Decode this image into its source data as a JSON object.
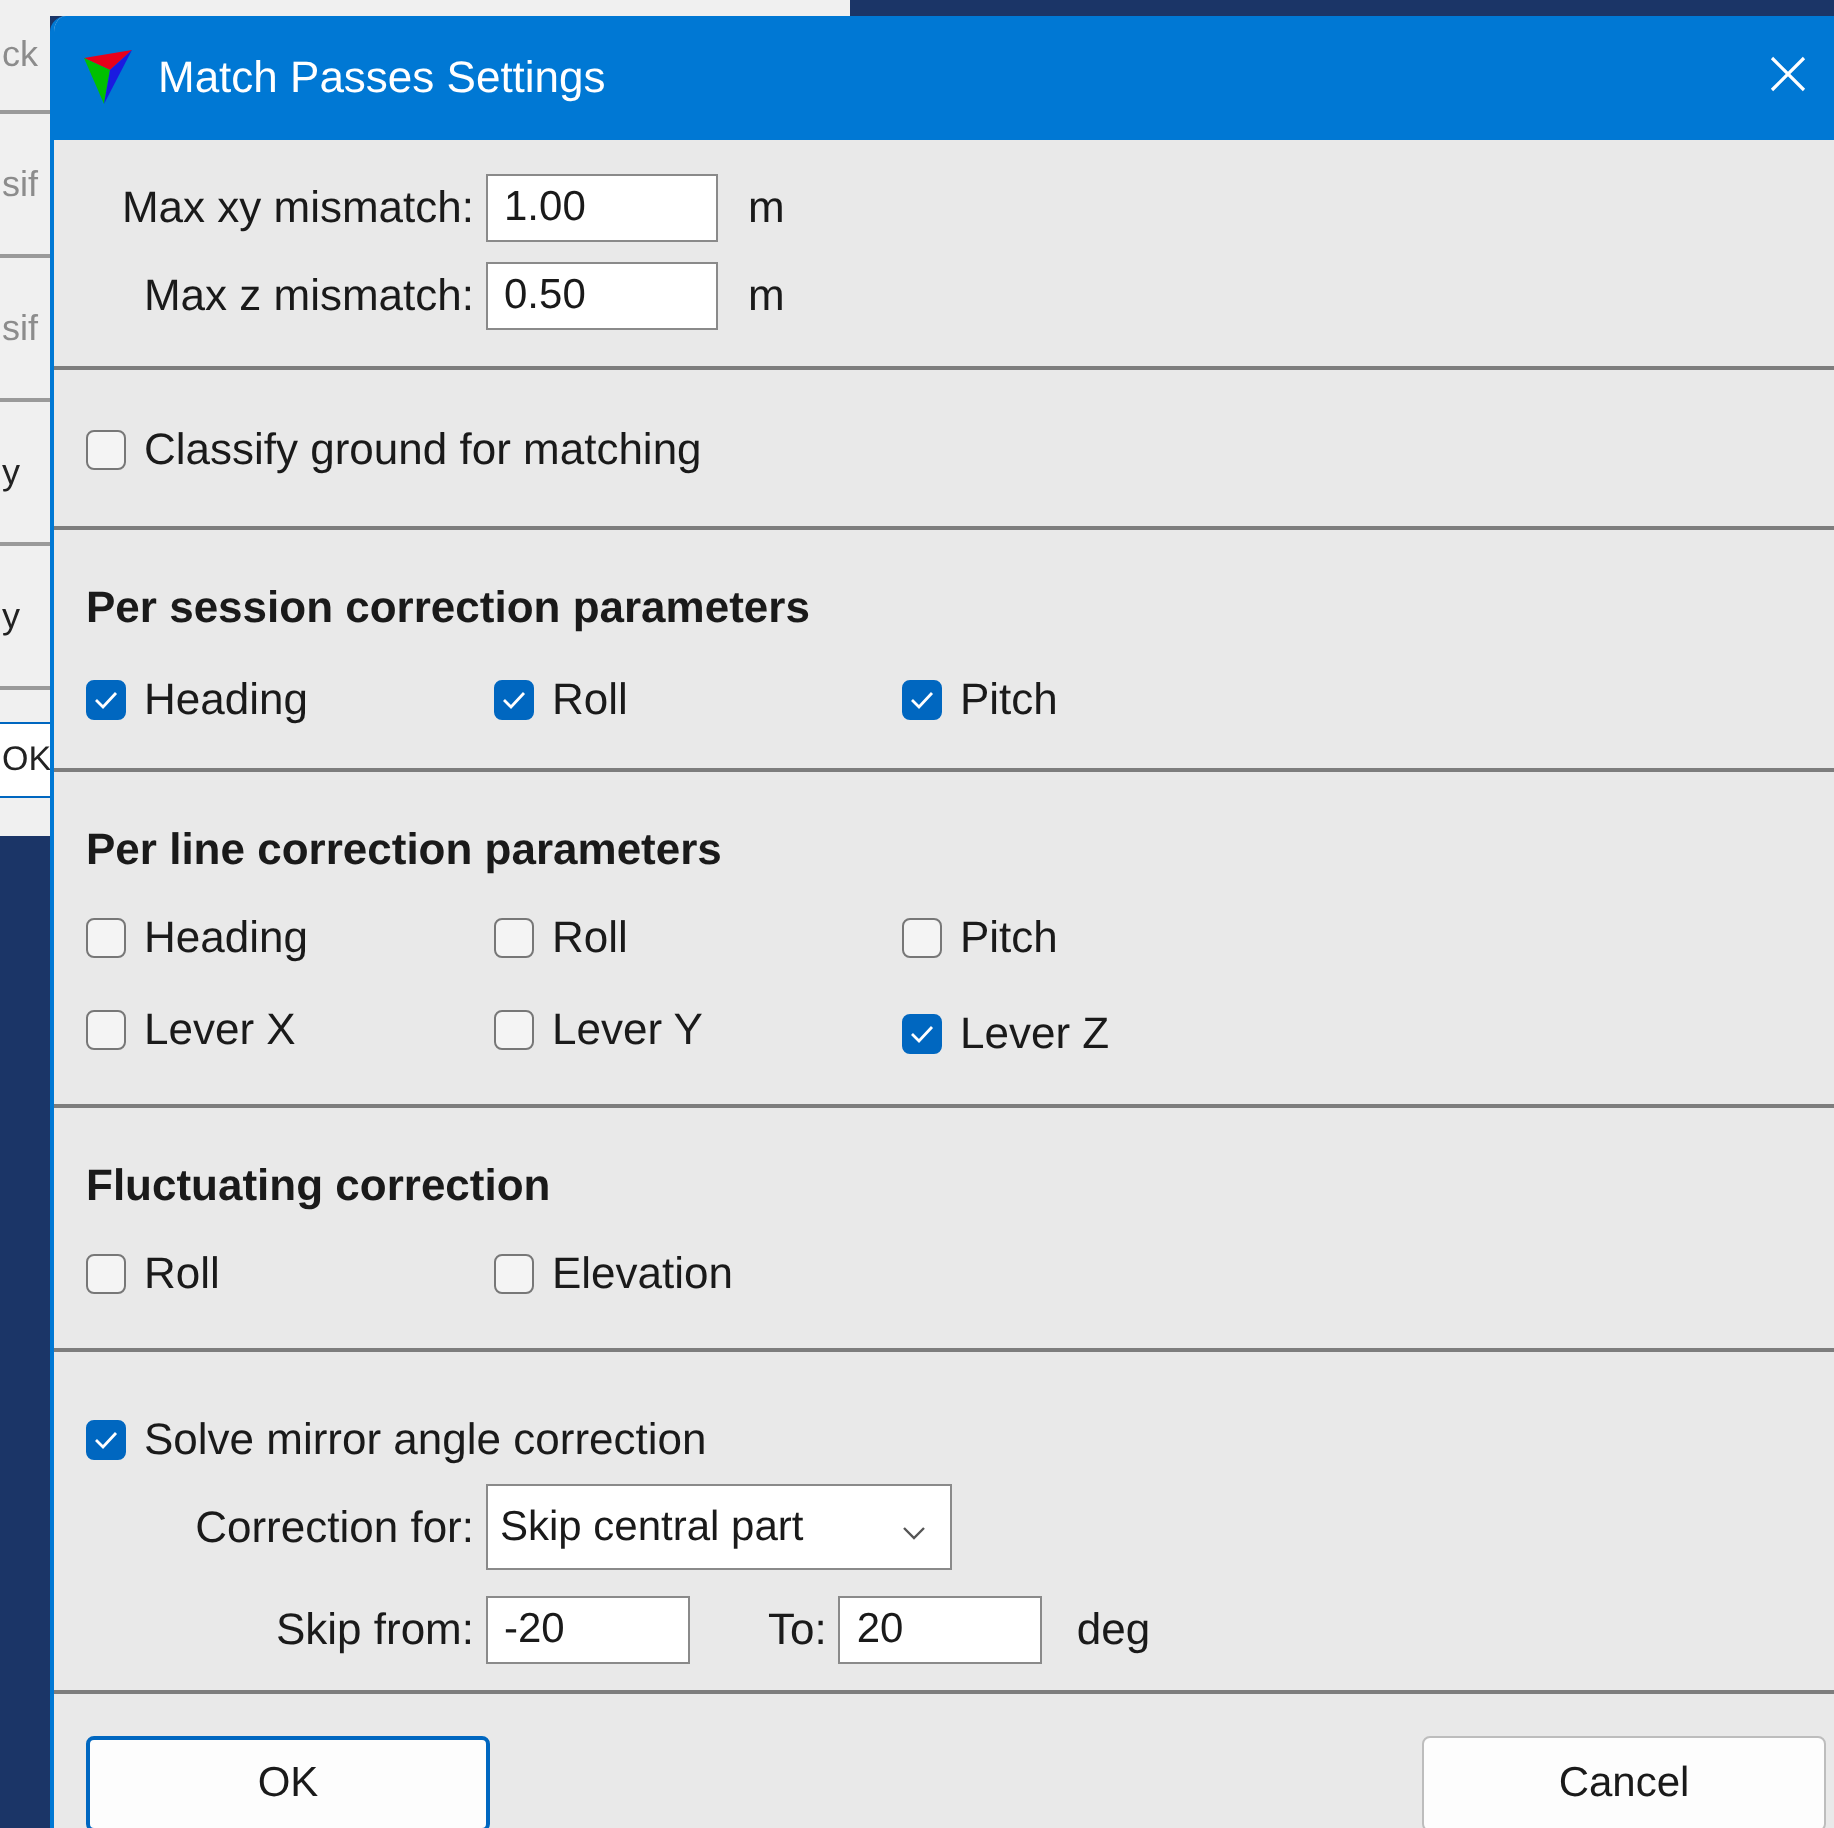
{
  "background_window": {
    "rows": [
      {
        "text": "ck",
        "disabled": true
      },
      {
        "text": "sif",
        "disabled": true
      },
      {
        "text": "sif",
        "disabled": true
      },
      {
        "text": "y",
        "disabled": false
      },
      {
        "text": "y",
        "disabled": false
      }
    ],
    "button": "OK"
  },
  "dialog": {
    "title": "Match Passes Settings",
    "fields": [
      {
        "label": "Max xy mismatch:",
        "value": "1.00",
        "unit": "m"
      },
      {
        "label": "Max z mismatch:",
        "value": "0.50",
        "unit": "m"
      }
    ],
    "classify_ground": {
      "label": "Classify ground for matching",
      "checked": false
    },
    "sections": [
      {
        "title": "Per session correction parameters",
        "rows": [
          [
            {
              "label": "Heading",
              "checked": true
            },
            {
              "label": "Roll",
              "checked": true
            },
            {
              "label": "Pitch",
              "checked": true
            }
          ]
        ]
      },
      {
        "title": "Per line correction parameters",
        "rows": [
          [
            {
              "label": "Heading",
              "checked": false
            },
            {
              "label": "Roll",
              "checked": false
            },
            {
              "label": "Pitch",
              "checked": false
            }
          ],
          [
            {
              "label": "Lever X",
              "checked": false
            },
            {
              "label": "Lever Y",
              "checked": false
            },
            {
              "label": "Lever Z",
              "checked": true
            }
          ]
        ]
      },
      {
        "title": "Fluctuating correction",
        "rows": [
          [
            {
              "label": "Roll",
              "checked": false
            },
            {
              "label": "Elevation",
              "checked": false
            }
          ]
        ]
      }
    ],
    "mirror": {
      "label": "Solve mirror angle correction",
      "checked": true,
      "correction_for": {
        "label": "Correction for:",
        "value": "Skip central part"
      },
      "skip_from": {
        "label": "Skip from:",
        "value": "-20"
      },
      "to": {
        "label": "To:",
        "value": "20"
      },
      "unit": "deg"
    },
    "buttons": [
      {
        "label": "OK",
        "default": true
      },
      {
        "label": "Cancel",
        "default": false
      }
    ]
  }
}
